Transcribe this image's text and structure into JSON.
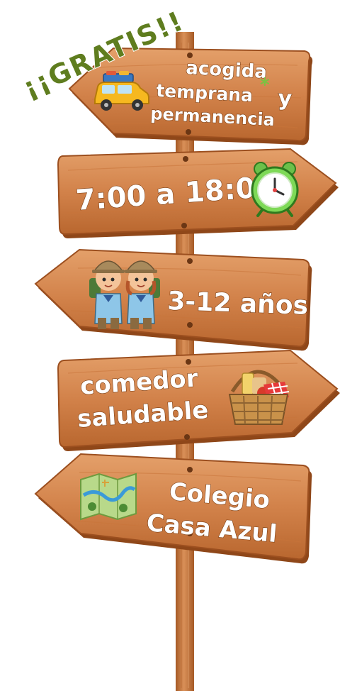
{
  "badge": {
    "text": "¡¡GRATIS!!",
    "color": "#5f7d1f"
  },
  "signs": [
    {
      "lines": [
        "acogida",
        "temprana",
        "y",
        "permanencia"
      ],
      "asterisk": "*",
      "direction": "left",
      "icon": "car-icon"
    },
    {
      "lines": [
        "7:00 a 18:00"
      ],
      "direction": "right",
      "icon": "alarm-clock-icon"
    },
    {
      "lines": [
        "3-12 años"
      ],
      "direction": "left",
      "icon": "kids-explorers-icon"
    },
    {
      "lines": [
        "comedor",
        "saludable"
      ],
      "direction": "right",
      "icon": "picnic-basket-icon"
    },
    {
      "lines": [
        "Colegio",
        "Casa Azul"
      ],
      "direction": "left",
      "icon": "map-icon"
    }
  ],
  "colors": {
    "wood": "#d2824a",
    "wood_dark": "#9c4f1f",
    "wood_light": "#e6a56d",
    "pole": "#c87a45",
    "text": "#ffffff",
    "asterisk": "#7cc142"
  }
}
